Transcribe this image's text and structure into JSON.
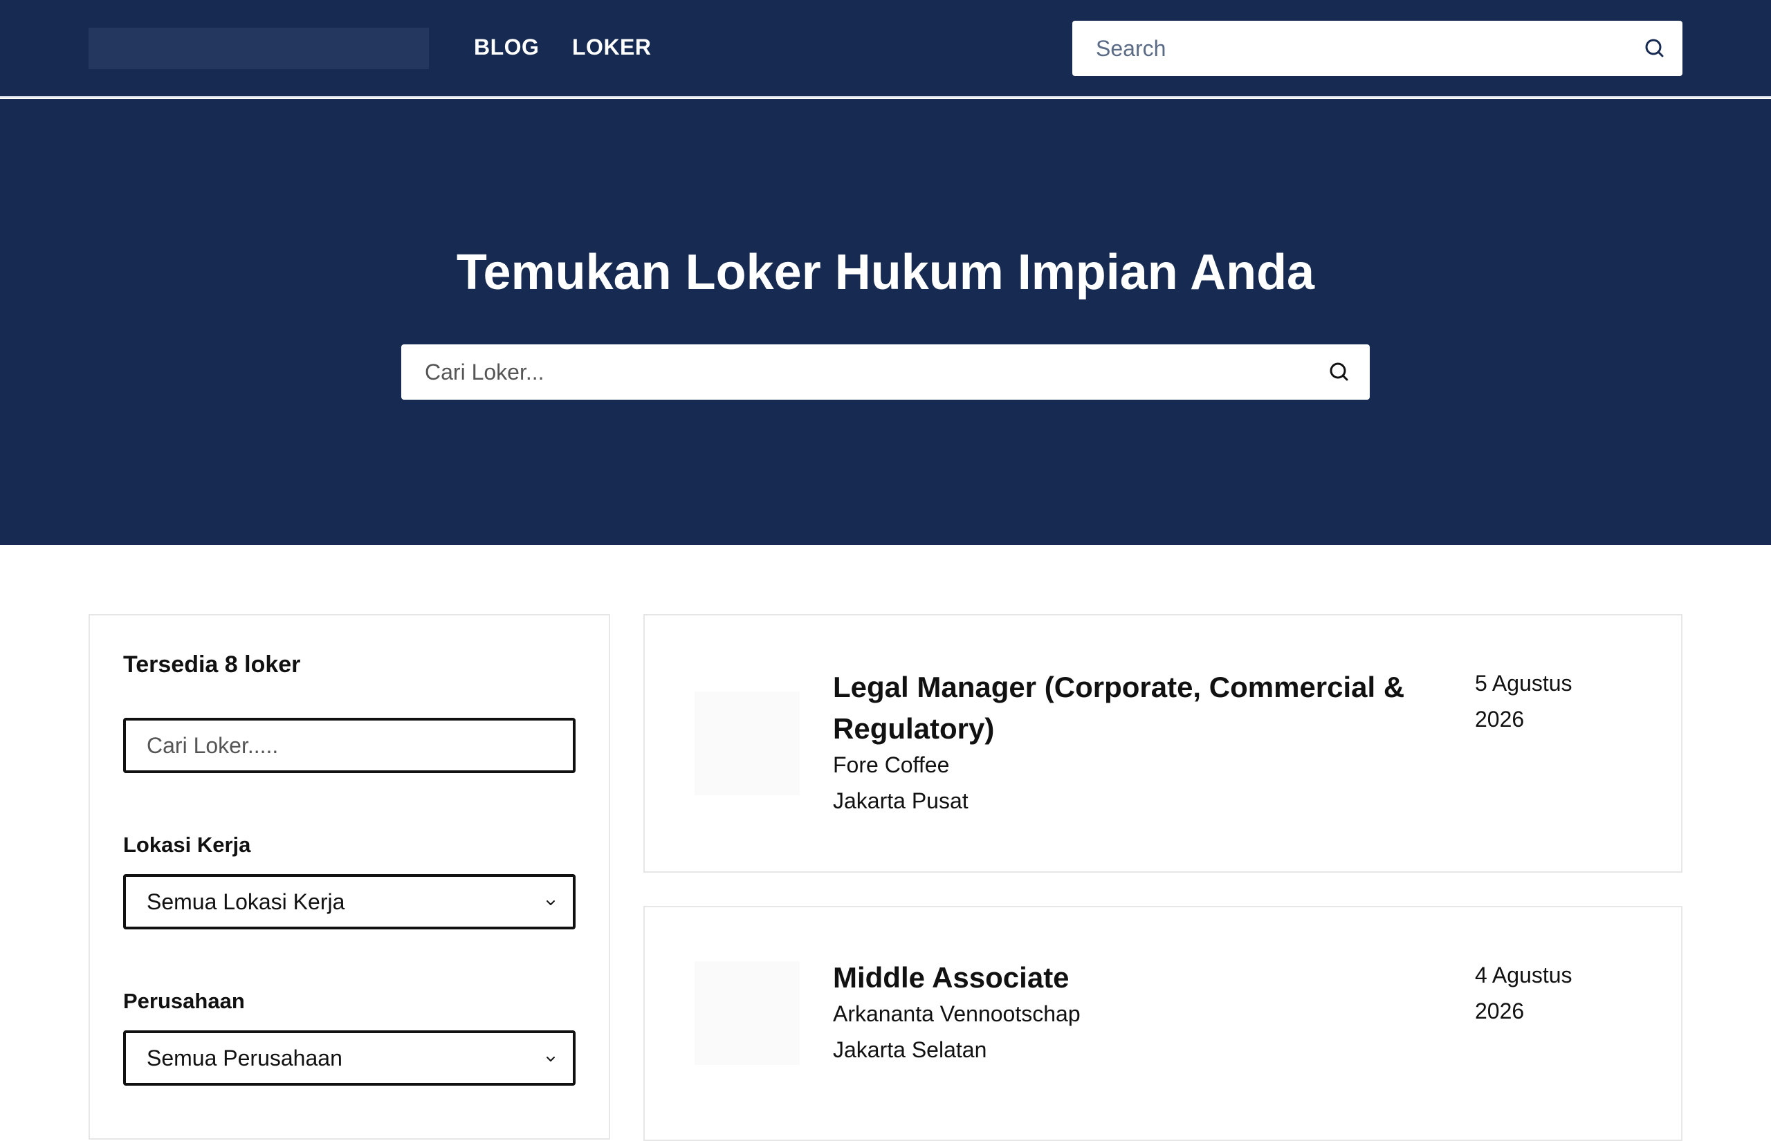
{
  "nav": {
    "links": [
      "BLOG",
      "LOKER"
    ],
    "search_placeholder": "Search"
  },
  "hero": {
    "title": "Temukan Loker Hukum Impian Anda",
    "search_placeholder": "Cari Loker..."
  },
  "sidebar": {
    "count_label": "Tersedia 8 loker",
    "search_placeholder": "Cari Loker.....",
    "location_label": "Lokasi Kerja",
    "location_value": "Semua Lokasi Kerja",
    "company_label": "Perusahaan",
    "company_value": "Semua Perusahaan"
  },
  "jobs": [
    {
      "title": "Legal Manager (Corporate, Commercial & Regulatory)",
      "company": "Fore Coffee",
      "location": "Jakarta Pusat",
      "date": "5 Agustus 2026"
    },
    {
      "title": "Middle Associate",
      "company": "Arkananta Vennootschap",
      "location": "Jakarta Selatan",
      "date": "4 Agustus 2026"
    }
  ],
  "colors": {
    "header_bg": "#172a51",
    "logo_placeholder": "#24375e"
  },
  "icons": [
    "search-icon",
    "chevron-down-icon"
  ]
}
